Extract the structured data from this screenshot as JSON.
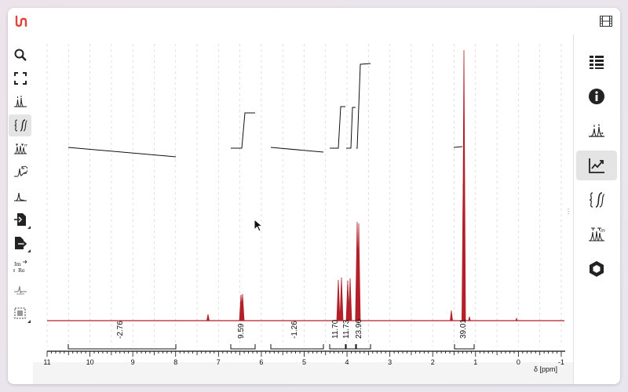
{
  "axis": {
    "label": "δ [ppm]",
    "ticks": [
      "11",
      "10",
      "9",
      "8",
      "7",
      "6",
      "5",
      "4",
      "3",
      "2",
      "1",
      "0",
      "-1"
    ]
  },
  "integrals": [
    {
      "value": "-2.76"
    },
    {
      "value": "9.59"
    },
    {
      "value": "-1.26"
    },
    {
      "value": "11.70"
    },
    {
      "value": "11.73"
    },
    {
      "value": "23.96"
    },
    {
      "value": "39.01"
    }
  ],
  "left_toolbar": {
    "items": [
      "search-icon",
      "fullscreen-icon",
      "peak-picking-icon",
      "integral-icon",
      "multiplet-icon",
      "phase-correction-icon",
      "baseline-icon",
      "import-icon",
      "export-icon",
      "real-imaginary-icon",
      "zero-filling-icon",
      "selection-icon"
    ],
    "active": "integral-icon"
  },
  "right_panel": {
    "items": [
      "spectra-list-icon",
      "info-icon",
      "peaks-icon",
      "chart-icon",
      "integrals-icon",
      "multiplet-analysis-icon",
      "structure-icon"
    ],
    "active": "chart-icon"
  },
  "colors": {
    "spectrum": "#b3202a",
    "brand": "#e4433c"
  }
}
